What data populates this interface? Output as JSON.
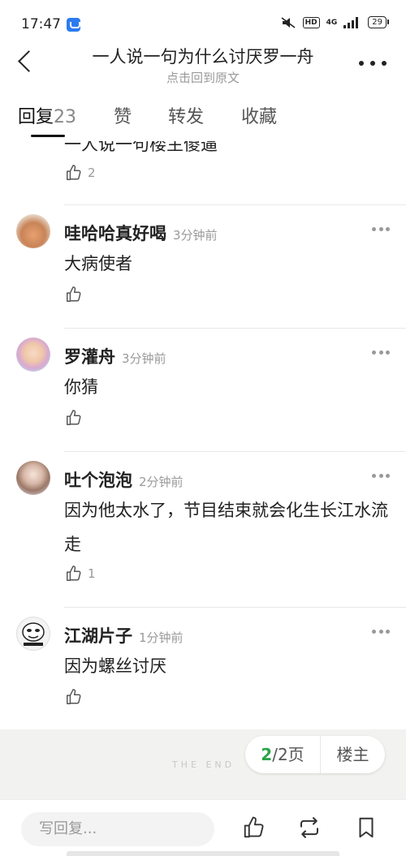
{
  "status_bar": {
    "time": "17:47",
    "hd": "HD",
    "network": "4G",
    "battery": "29"
  },
  "nav": {
    "title": "一人说一句为什么讨厌罗一舟",
    "subtitle": "点击回到原文"
  },
  "tabs": [
    {
      "label": "回复",
      "count": "23"
    },
    {
      "label": "赞"
    },
    {
      "label": "转发"
    },
    {
      "label": "收藏"
    }
  ],
  "partial_reply": {
    "content": "一人说一句楼主傻逼",
    "likes": "2"
  },
  "replies": [
    {
      "username": "哇哈哈真好喝",
      "time": "3分钟前",
      "content": "大病使者",
      "likes": ""
    },
    {
      "username": "罗灌舟",
      "time": "3分钟前",
      "content": "你猜",
      "likes": ""
    },
    {
      "username": "吐个泡泡",
      "time": "2分钟前",
      "content": "因为他太水了，节目结束就会化生长江水流走",
      "likes": "1"
    },
    {
      "username": "江湖片子",
      "time": "1分钟前",
      "content": "因为螺丝讨厌",
      "likes": ""
    }
  ],
  "footer": {
    "end_text": "THE END",
    "page_current": "2",
    "page_total": "/2页",
    "owner_label": "楼主"
  },
  "bottom_bar": {
    "input_placeholder": "写回复..."
  },
  "icons": {
    "back": "back-arrow-icon",
    "more": "more-dots-icon",
    "thumb": "thumbs-up-icon",
    "repost": "repost-icon",
    "bookmark": "bookmark-icon"
  },
  "colors": {
    "accent_green": "#2aa34a",
    "muted_text": "#999999",
    "end_bar_bg": "#f2f2f0"
  }
}
